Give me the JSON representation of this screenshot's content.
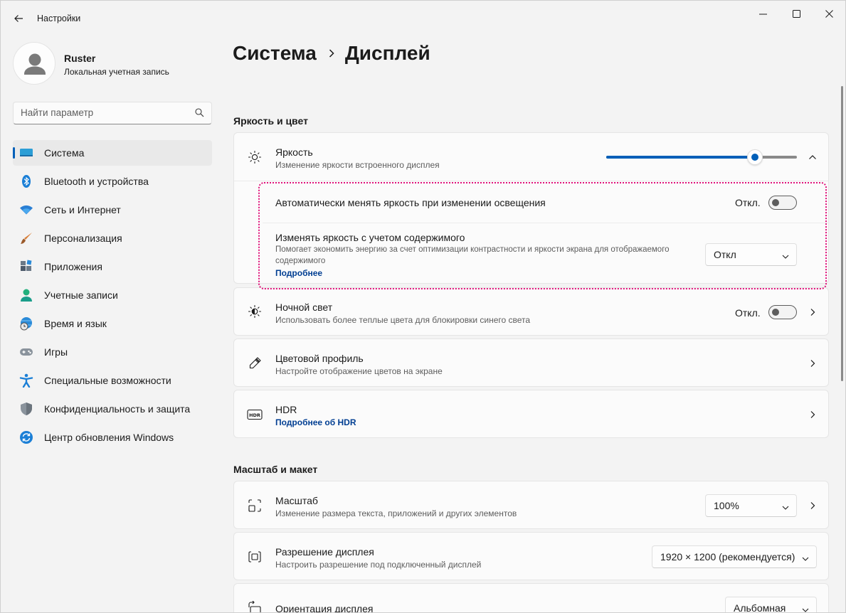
{
  "window": {
    "app_title": "Настройки"
  },
  "user": {
    "name": "Ruster",
    "account_type": "Локальная учетная запись"
  },
  "search": {
    "placeholder": "Найти параметр"
  },
  "sidebar": {
    "items": [
      {
        "label": "Система",
        "icon": "system-icon",
        "active": true
      },
      {
        "label": "Bluetooth и устройства",
        "icon": "bluetooth-icon"
      },
      {
        "label": "Сеть и Интернет",
        "icon": "wifi-icon"
      },
      {
        "label": "Персонализация",
        "icon": "brush-icon"
      },
      {
        "label": "Приложения",
        "icon": "apps-icon"
      },
      {
        "label": "Учетные записи",
        "icon": "person-icon"
      },
      {
        "label": "Время и язык",
        "icon": "globe-clock-icon"
      },
      {
        "label": "Игры",
        "icon": "gamepad-icon"
      },
      {
        "label": "Специальные возможности",
        "icon": "accessibility-icon"
      },
      {
        "label": "Конфиденциальность и защита",
        "icon": "shield-icon"
      },
      {
        "label": "Центр обновления Windows",
        "icon": "update-icon"
      }
    ]
  },
  "breadcrumb": {
    "parent": "Система",
    "current": "Дисплей"
  },
  "sections": {
    "brightness_color": "Яркость и цвет",
    "scale_layout": "Масштаб и макет"
  },
  "brightness": {
    "title": "Яркость",
    "subtitle": "Изменение яркости встроенного дисплея",
    "level_fraction": 0.78,
    "auto_title": "Автоматически менять яркость при изменении освещения",
    "auto_state": "Откл.",
    "content_title": "Изменять яркость с учетом содержимого",
    "content_desc_line1": "Помогает экономить энергию за счет оптимизации контрастности и яркости экрана для отображаемого",
    "content_desc_line2": "содержимого",
    "content_link": "Подробнее",
    "content_value": "Откл"
  },
  "night_light": {
    "title": "Ночной свет",
    "subtitle": "Использовать более теплые цвета для блокировки синего света",
    "state": "Откл."
  },
  "color_profile": {
    "title": "Цветовой профиль",
    "subtitle": "Настройте отображение цветов на экране"
  },
  "hdr": {
    "title": "HDR",
    "link": "Подробнее об HDR"
  },
  "scale": {
    "title": "Масштаб",
    "subtitle": "Изменение размера текста, приложений и других элементов",
    "value": "100%"
  },
  "resolution": {
    "title": "Разрешение дисплея",
    "subtitle": "Настроить разрешение под подключенный дисплей",
    "value": "1920 × 1200 (рекомендуется)"
  },
  "orientation": {
    "title": "Ориентация дисплея",
    "value": "Альбомная"
  },
  "colors": {
    "accent": "#005fb8",
    "highlight": "#e0127a"
  }
}
